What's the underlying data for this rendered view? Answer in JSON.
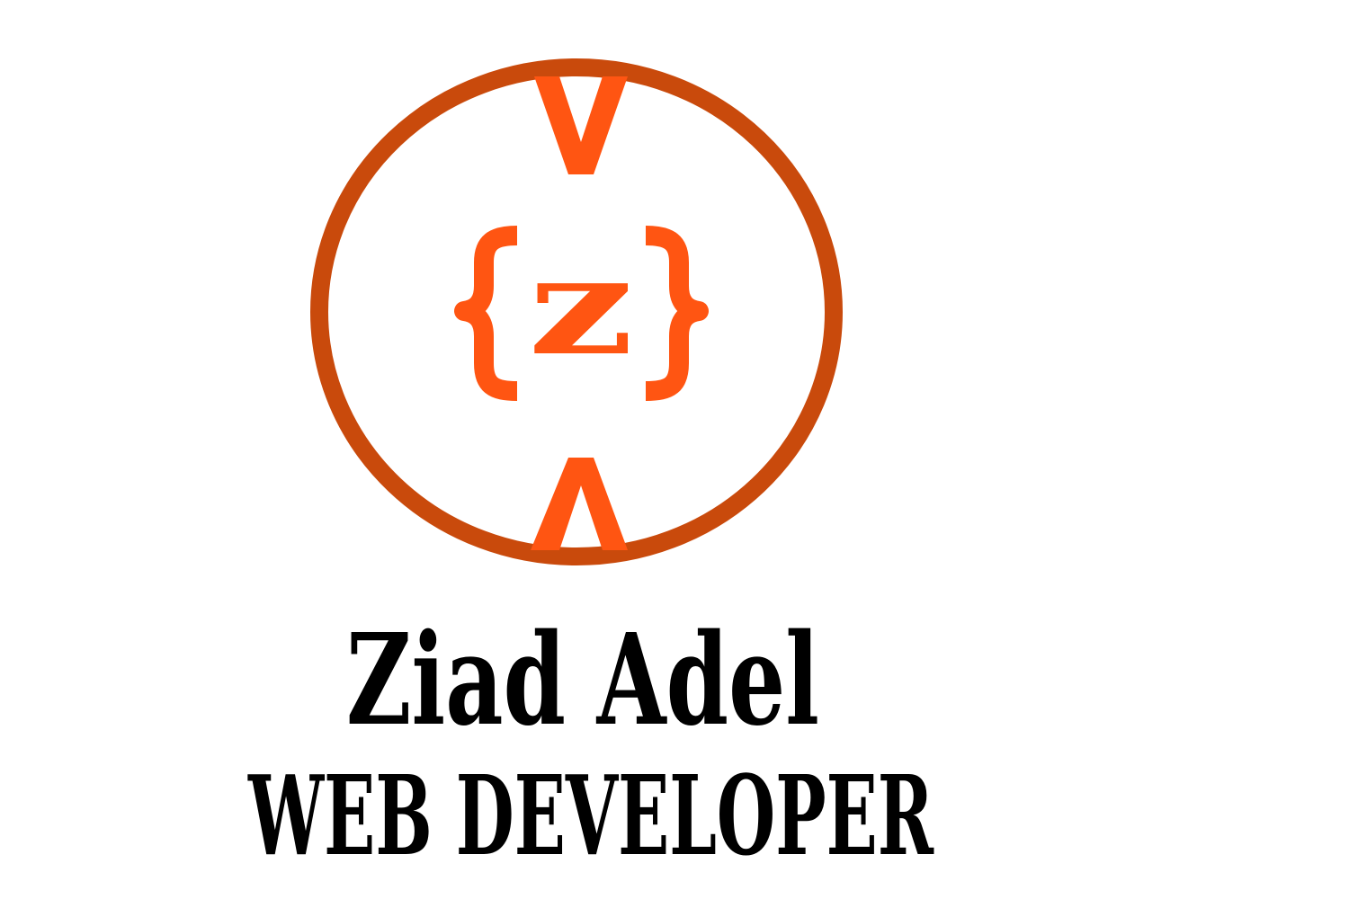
{
  "logo": {
    "letter": "z",
    "open_brace": "{",
    "close_brace": "}",
    "ring_color": "#C94A0C",
    "accent_color": "#FF5512",
    "icons": [
      "ring-icon",
      "down-chevron-icon",
      "up-chevron-icon",
      "open-brace-icon",
      "close-brace-icon"
    ]
  },
  "title": {
    "name": "Ziad Adel",
    "role": "WEB DEVELOPER",
    "color": "#000000"
  }
}
